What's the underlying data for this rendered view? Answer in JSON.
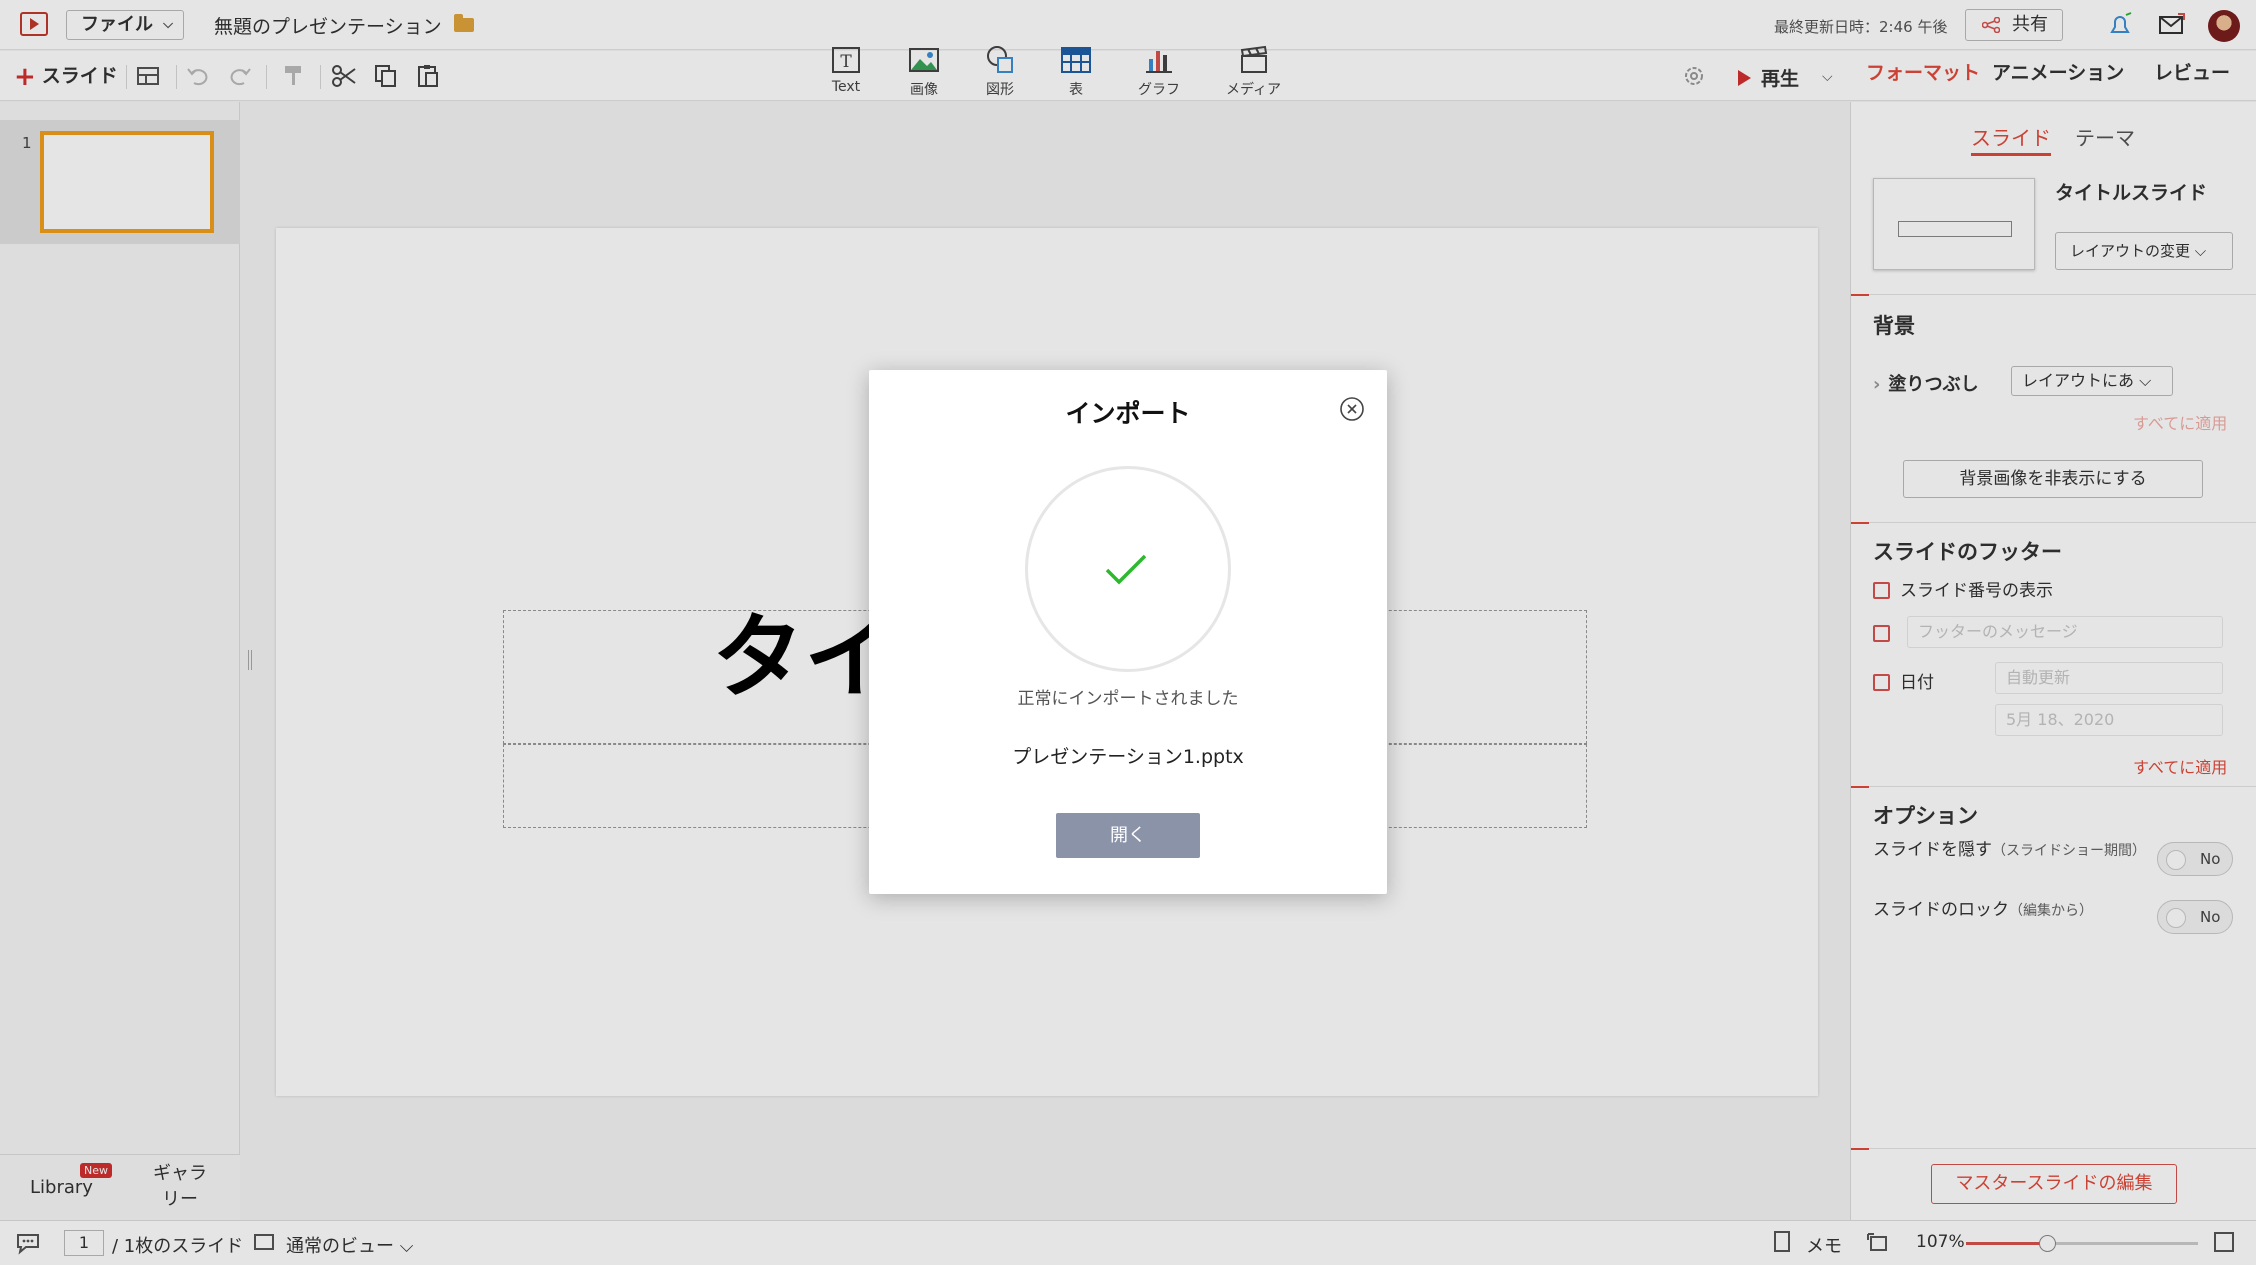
{
  "topbar": {
    "file_menu": "ファイル",
    "doc_title": "無題のプレゼンテーション",
    "last_updated": "最終更新日時：2:46 午後",
    "share": "共有"
  },
  "toolbar": {
    "add_slide": "スライド",
    "insert": {
      "text": "Text",
      "image": "画像",
      "shape": "図形",
      "table": "表",
      "chart": "グラフ",
      "media": "メディア"
    },
    "play": "再生"
  },
  "right_tabs": [
    "フォーマット",
    "アニメーション",
    "レビュー"
  ],
  "left_panel": {
    "slide_number": "1",
    "library": "Library",
    "new_badge": "New",
    "gallery": "ギャラリー"
  },
  "slide": {
    "title_text": "タイ"
  },
  "format_panel": {
    "sub_tabs": [
      "スライド",
      "テーマ"
    ],
    "layout_name": "タイトルスライド",
    "layout_change": "レイアウトの変更",
    "background_title": "背景",
    "fill_label": "塗りつぶし",
    "fill_value": "レイアウトにあ",
    "apply_all": "すべてに適用",
    "hide_bg_button": "背景画像を非表示にする",
    "footer_title": "スライドのフッター",
    "show_slide_number": "スライド番号の表示",
    "footer_message_placeholder": "フッターのメッセージ",
    "date_label": "日付",
    "date_mode": "自動更新",
    "date_value": "5月 18、2020",
    "footer_apply_all": "すべてに適用",
    "options_title": "オプション",
    "hide_slide": "スライドを隠す",
    "hide_slide_note": "（スライドショー期間）",
    "lock_slide": "スライドのロック",
    "lock_slide_note": "（編集から）",
    "toggle_off": "No",
    "master_edit": "マスタースライドの編集"
  },
  "statusbar": {
    "page_current": "1",
    "page_total": "/ 1枚のスライド",
    "view_mode": "通常のビュー",
    "memo": "メモ",
    "zoom": "107%",
    "zoom_fraction": 0.35
  },
  "dialog": {
    "title": "インポート",
    "status": "正常にインポートされました",
    "filename": "プレゼンテーション1.pptx",
    "open_button": "開く"
  },
  "colors": {
    "accent": "#e24a3b",
    "success_check": "#2eb82e",
    "thumb_border": "#f29f1a",
    "open_button_bg": "#8b93a8"
  }
}
